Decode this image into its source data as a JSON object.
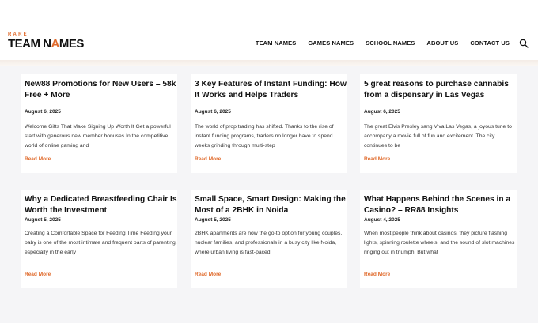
{
  "site": {
    "logo_top": "RARE",
    "logo_main_a": "TEAM N",
    "logo_main_b": "A",
    "logo_main_c": "MES"
  },
  "nav": {
    "items": [
      {
        "label": "TEAM NAMES"
      },
      {
        "label": "GAMES NAMES"
      },
      {
        "label": "SCHOOL NAMES"
      },
      {
        "label": "ABOUT US"
      },
      {
        "label": "CONTACT US"
      }
    ],
    "search_icon": "search-icon"
  },
  "posts": [
    {
      "title": "New88 Promotions for New Users – 58k Free + More",
      "date": "August 6, 2025",
      "excerpt": "Welcome Gifts That Make Signing Up Worth It Get a powerful start with generous new member bonuses In the competitive world of online gaming and",
      "link": "Read More"
    },
    {
      "title": "3 Key Features of Instant Funding: How It Works and Helps Traders",
      "date": "August 6, 2025",
      "excerpt": "The world of prop trading has shifted. Thanks to the rise of instant funding programs, traders no longer have to spend weeks grinding through multi-step",
      "link": "Read More"
    },
    {
      "title": "5 great reasons to purchase cannabis from a dispensary in Las Vegas",
      "date": "August 6, 2025",
      "excerpt": "The great Elvis Presley sang Viva Las Vegas, a joyous tune to accompany a movie full of fun and excitement. The city continues to be",
      "link": "Read More"
    },
    {
      "title": "Why a Dedicated Breastfeeding Chair Is Worth the Investment",
      "date": "August 5, 2025",
      "excerpt": "Creating a Comfortable Space for Feeding Time Feeding your baby is one of the most intimate and frequent parts of parenting, especially in the early",
      "link": "Read More"
    },
    {
      "title": "Small Space, Smart Design: Making the Most of a 2BHK in Noida",
      "date": "August 5, 2025",
      "excerpt": "2BHK apartments are now the go-to option for young couples, nuclear families, and professionals in a busy city like Noida, where urban living is fast-paced",
      "link": "Read More"
    },
    {
      "title": "What Happens Behind the Scenes in a Casino? – RR88 Insights",
      "date": "August 4, 2025",
      "excerpt": "When most people think about casinos, they picture flashing lights, spinning roulette wheels, and the sound of slot machines ringing out in triumph. But what",
      "link": "Read More"
    }
  ],
  "colors": {
    "accent": "#e06a2b",
    "background": "#f5f5f7"
  }
}
